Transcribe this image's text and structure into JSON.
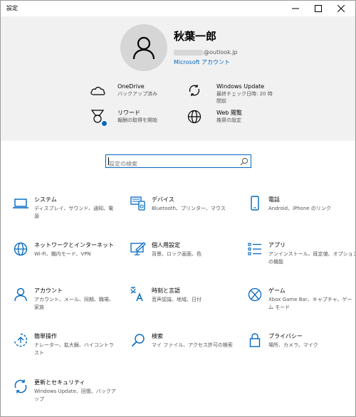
{
  "window": {
    "title": "設定"
  },
  "account": {
    "name": "秋葉一郎",
    "email_domain": "@outlook.jp",
    "account_link": "Microsoft アカウント"
  },
  "services": [
    {
      "title": "OneDrive",
      "subtitle": "バックアップ済み",
      "icon": "cloud-icon"
    },
    {
      "title": "Windows Update",
      "subtitle": "最終チェック日時: 20 時間前",
      "icon": "sync-icon"
    },
    {
      "title": "リワード",
      "subtitle": "報酬の取得を開始",
      "icon": "medal-icon"
    },
    {
      "title": "Web 閲覧",
      "subtitle": "推奨の設定",
      "icon": "globe-icon"
    }
  ],
  "search": {
    "placeholder": "設定の検索"
  },
  "categories": [
    {
      "name": "システム",
      "desc": "ディスプレイ、サウンド、通知、電源",
      "icon": "laptop-icon"
    },
    {
      "name": "デバイス",
      "desc": "Bluetooth、プリンター、マウス",
      "icon": "devices-icon"
    },
    {
      "name": "電話",
      "desc": "Android、iPhone のリンク",
      "icon": "phone-icon"
    },
    {
      "name": "ネットワークとインターネット",
      "desc": "Wi-Fi、機内モード、VPN",
      "icon": "globe-icon"
    },
    {
      "name": "個人用設定",
      "desc": "背景、ロック画面、色",
      "icon": "personalization-icon"
    },
    {
      "name": "アプリ",
      "desc": "アンインストール、既定値、オプションの機能",
      "icon": "apps-list-icon"
    },
    {
      "name": "アカウント",
      "desc": "アカウント、メール、同期、職場、家族",
      "icon": "person-icon"
    },
    {
      "name": "時刻と言語",
      "desc": "音声認識、地域、日付",
      "icon": "time-language-icon"
    },
    {
      "name": "ゲーム",
      "desc": "Xbox Game Bar、キャプチャ、ゲーム モード",
      "icon": "xbox-icon"
    },
    {
      "name": "簡単操作",
      "desc": "ナレーター、拡大鏡、ハイコントラスト",
      "icon": "ease-of-access-icon"
    },
    {
      "name": "検索",
      "desc": "マイ ファイル、アクセス許可の検索",
      "icon": "search-icon"
    },
    {
      "name": "プライバシー",
      "desc": "場所、カメラ、マイク",
      "icon": "lock-icon"
    },
    {
      "name": "更新とセキュリティ",
      "desc": "Windows Update、回復、バックアップ",
      "icon": "sync-icon"
    }
  ],
  "colors": {
    "accent": "#0067c0",
    "header_bg": "#f1f1f1"
  }
}
